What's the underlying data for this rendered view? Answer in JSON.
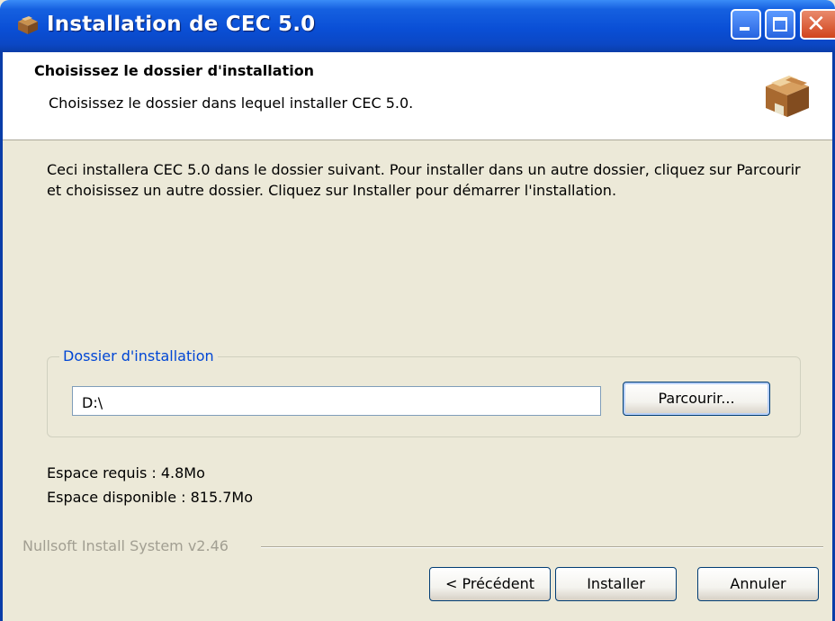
{
  "window": {
    "title": "Installation de CEC 5.0",
    "icon": "package-box-icon",
    "controls": {
      "minimize": "minimize-icon",
      "maximize": "maximize-icon",
      "close_glyph": "✕"
    }
  },
  "header": {
    "title": "Choisissez le dossier d'installation",
    "subtitle": "Choisissez le dossier dans lequel installer CEC 5.0.",
    "icon": "package-box-icon"
  },
  "body": {
    "description": "Ceci installera CEC 5.0 dans le dossier suivant. Pour installer dans un autre dossier, cliquez sur Parcourir et choisissez un autre dossier. Cliquez sur Installer pour démarrer l'installation.",
    "folder_group": {
      "legend": "Dossier d'installation",
      "path_value": "D:\\",
      "browse_label": "Parcourir..."
    },
    "space_required": "Espace requis : 4.8Mo",
    "space_available": "Espace disponible : 815.7Mo"
  },
  "footer": {
    "branding": "Nullsoft Install System v2.46",
    "back_label": "< Précédent",
    "install_label": "Installer",
    "cancel_label": "Annuler"
  },
  "colors": {
    "titlebar": "#0a4fd6",
    "legend_text": "#0046d5",
    "dialog_background": "#ece9d8",
    "branding_text": "#a29f92"
  }
}
